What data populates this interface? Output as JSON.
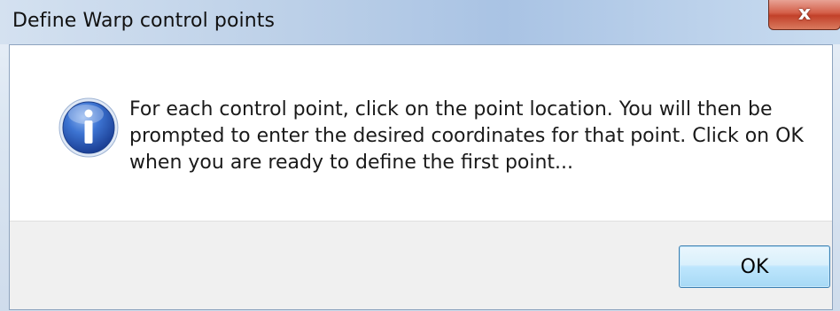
{
  "dialog": {
    "title": "Define Warp control points",
    "close_icon_glyph": "x",
    "message": "For each control point, click on the point location.  You will then be\nprompted to enter the desired coordinates for that point. Click on OK\nwhen you are ready to define the first point...",
    "icon": "information-icon",
    "ok_label": "OK"
  },
  "colors": {
    "title_gradient": [
      "#d4e1f0",
      "#a9c3e4"
    ],
    "close_button": "#c2412a",
    "ok_button_border": "#3c7fb1",
    "info_icon_blue": "#2b63c4",
    "button_area": "#f0f0f0"
  }
}
